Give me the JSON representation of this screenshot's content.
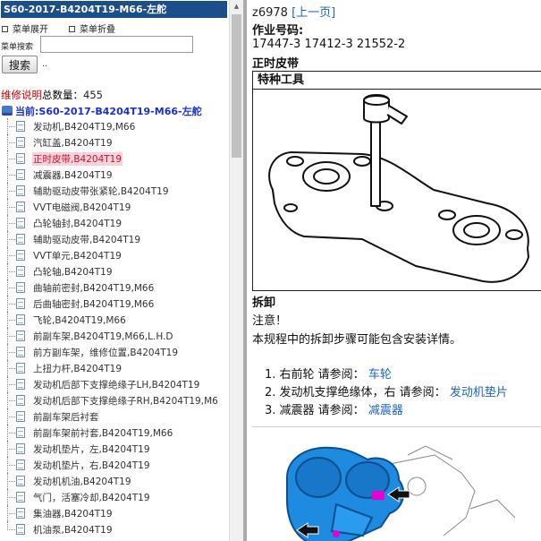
{
  "colors": {
    "title_bar": "#1c4f8a",
    "selected_bg": "#f5d3da",
    "selected_text": "#d0103a",
    "link": "#1c63c7",
    "count_label": "#c00000",
    "current_label": "#1a2fd0"
  },
  "left_panel": {
    "title": "S60-2017-B4204T19-M66-左舵",
    "expand_menu": "菜单展开",
    "collapse_menu": "菜单折叠",
    "search_label": "菜单搜索",
    "search_value": "",
    "search_button": "搜索",
    "search_dots": "..",
    "count_label": "维修说明",
    "count_text": "总数量：",
    "count_value": "455",
    "current_label": "当前:S60-2017-B4204T19-M66-左舵",
    "current_icon": "computer-icon",
    "selected_index": 2,
    "items": [
      "发动机,B4204T19,M66",
      "汽缸盖,B4204T19",
      "正时皮带,B4204T19",
      "减震器,B4204T19",
      "辅助驱动皮带张紧轮,B4204T19",
      "VVT电磁阀,B4204T19",
      "凸轮轴封,B4204T19",
      "辅助驱动皮带,B4204T19",
      "VVT单元,B4204T19",
      "凸轮轴,B4204T19",
      "曲轴前密封,B4204T19,M66",
      "后曲轴密封,B4204T19,M66",
      "飞轮,B4204T19,M66",
      "前副车架,B4204T19,M66,L.H.D",
      "前方副车架，维修位置,B4204T19",
      "上扭力杆,B4204T19",
      "发动机后部下支撑绝缘子LH,B4204T19",
      "发动机后部下支撑绝缘子RH,B4204T19,M6",
      "前副车架后衬套",
      "前副车架前衬套,B4204T19,M66",
      "发动机垫片，左,B4204T19",
      "发动机垫片，右,B4204T19",
      "发动机机油,B4204T19",
      "气门，活塞冷却,B4204T19",
      "集油器,B4204T19",
      "机油泵,B4204T19"
    ]
  },
  "right_panel": {
    "doc_id": "z6978",
    "prev_link": "[上一页]",
    "op_number_label": "作业号码:",
    "op_numbers": "17447-3 17412-3 21552-2",
    "section_title": "正时皮带",
    "tools_header": "特种工具",
    "removal_title": "拆卸",
    "notice_title": "注意！",
    "notice_text": "本规程中的拆卸步骤可能包含安装详情。",
    "steps": [
      {
        "num": "1.",
        "text": "右前轮 请参阅：",
        "link": "车轮"
      },
      {
        "num": "2.",
        "text": "发动机支撑绝缘体，右 请参阅：",
        "link": "发动机垫片"
      },
      {
        "num": "3.",
        "text": "减震器 请参阅：",
        "link": "减震器"
      }
    ]
  }
}
